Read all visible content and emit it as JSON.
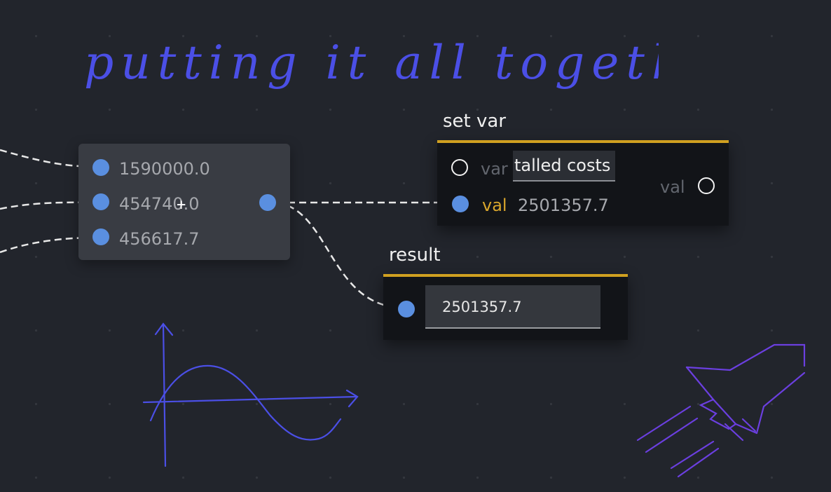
{
  "canvas": {
    "heading": "putting it all together"
  },
  "sum_node": {
    "inputs": [
      "1590000.0",
      "454740.0",
      "456617.7"
    ]
  },
  "set_var_node": {
    "title": "set var",
    "var_label": "var",
    "var_value": "talled costs",
    "val_label": "val",
    "val_value": "2501357.7",
    "output_label": "val"
  },
  "result_node": {
    "title": "result",
    "value": "2501357.7"
  },
  "colors": {
    "canvas_bg": "#22252c",
    "accent": "#d0a020",
    "port": "#5a8fe0",
    "ink": "#4b4fe6"
  },
  "icons": {
    "sketch_1": "sine-graph-sketch-icon",
    "sketch_2": "rocket-sketch-icon"
  }
}
